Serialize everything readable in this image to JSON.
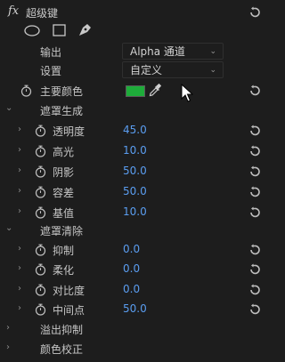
{
  "effect": {
    "fx_label": "fx",
    "title": "超级键"
  },
  "rows": {
    "output": {
      "label": "输出",
      "value": "Alpha 通道"
    },
    "settings": {
      "label": "设置",
      "value": "自定义"
    },
    "key_color": {
      "label": "主要颜色",
      "color": "#1eac3a"
    }
  },
  "groups": {
    "matte_generation": {
      "title": "遮罩生成",
      "params": [
        {
          "label": "透明度",
          "value": "45.0"
        },
        {
          "label": "高光",
          "value": "10.0"
        },
        {
          "label": "阴影",
          "value": "50.0"
        },
        {
          "label": "容差",
          "value": "50.0"
        },
        {
          "label": "基值",
          "value": "10.0"
        }
      ]
    },
    "matte_cleanup": {
      "title": "遮罩清除",
      "params": [
        {
          "label": "抑制",
          "value": "0.0"
        },
        {
          "label": "柔化",
          "value": "0.0"
        },
        {
          "label": "对比度",
          "value": "0.0"
        },
        {
          "label": "中间点",
          "value": "50.0"
        }
      ]
    },
    "spill_suppression": {
      "title": "溢出抑制"
    },
    "color_correction": {
      "title": "颜色校正"
    }
  },
  "icons": {
    "reset": "reset-icon",
    "stopwatch": "stopwatch-icon",
    "ellipse_mask": "ellipse-mask-icon",
    "rect_mask": "rectangle-mask-icon",
    "pen_mask": "pen-mask-icon",
    "eyedropper": "eyedropper-icon",
    "cursor": "mouse-cursor-icon"
  }
}
